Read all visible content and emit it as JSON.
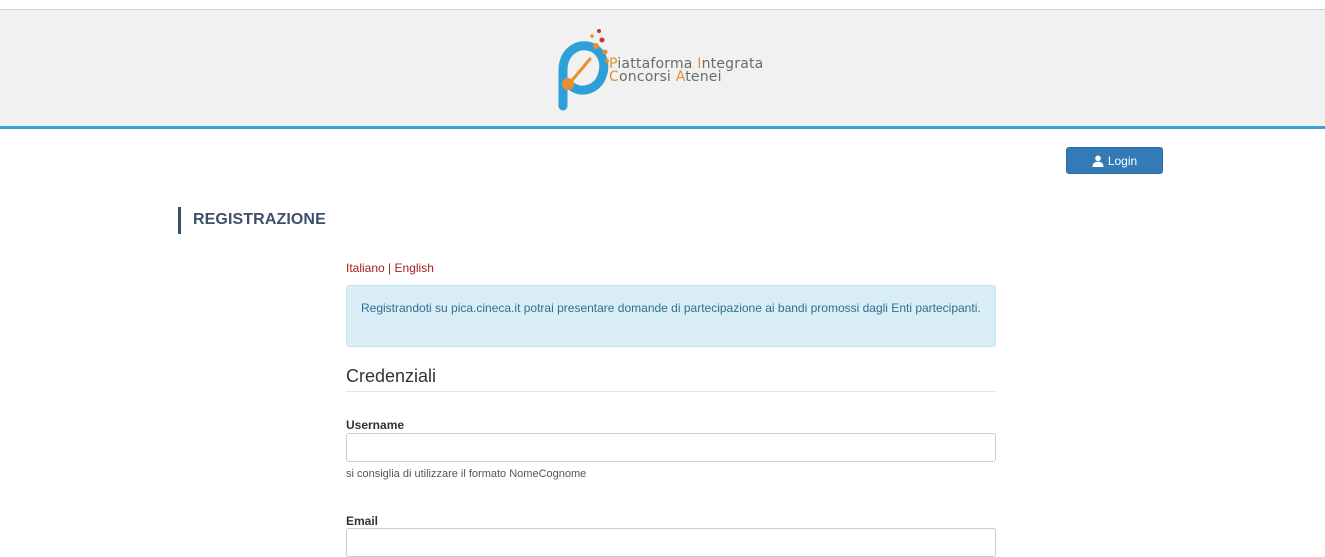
{
  "header": {
    "logo": {
      "line1": [
        {
          "cap": "P",
          "rest": "iattaforma "
        },
        {
          "cap": "I",
          "rest": "ntegrata"
        }
      ],
      "line2": [
        {
          "cap": "C",
          "rest": "oncorsi "
        },
        {
          "cap": "A",
          "rest": "tenei"
        }
      ],
      "colors": {
        "blue": "#2f9fd8",
        "orange": "#e8902e",
        "red": "#c0392b"
      }
    }
  },
  "login": {
    "label": "Login",
    "icon": "user-icon"
  },
  "section": {
    "title": "REGISTRAZIONE"
  },
  "language": {
    "italian": "Italiano",
    "separator": "|",
    "english": "English"
  },
  "info": {
    "text": "Registrandoti su pica.cineca.it potrai presentare domande di partecipazione ai bandi promossi dagli Enti partecipanti."
  },
  "form": {
    "section_title": "Credenziali",
    "username": {
      "label": "Username",
      "value": "",
      "placeholder": "",
      "hint": "si consiglia di utilizzare il formato NomeCognome"
    },
    "email": {
      "label": "Email",
      "value": "",
      "placeholder": ""
    }
  },
  "colors": {
    "accent": "#337ab7",
    "header_border": "#3ea0d8",
    "title": "#3e4f6b",
    "info_bg": "#d9edf7",
    "link": "#a31f1f"
  }
}
